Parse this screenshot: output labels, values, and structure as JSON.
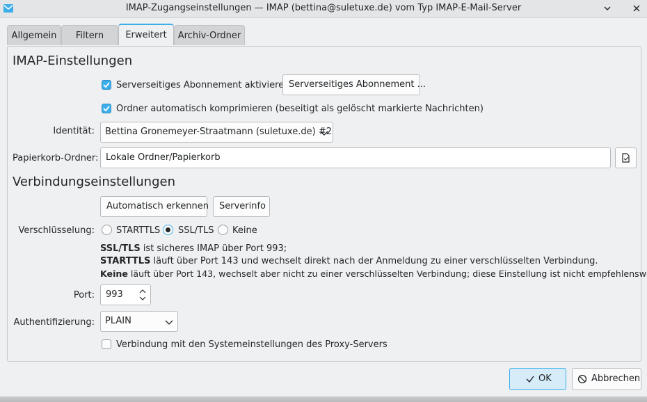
{
  "window": {
    "title": "IMAP-Zugangseinstellungen — IMAP (bettina@suletuxe.de) vom Typ IMAP-E-Mail-Server"
  },
  "tabs": [
    {
      "label": "Allgemein",
      "active": false
    },
    {
      "label": "Filtern",
      "active": false
    },
    {
      "label": "Erweitert",
      "active": true
    },
    {
      "label": "Archiv-Ordner",
      "active": false
    }
  ],
  "imap": {
    "heading": "IMAP-Einstellungen",
    "subscription_label": "Serverseitiges Abonnement aktivieren",
    "subscription_checked": true,
    "subscription_button": "Serverseitiges Abonnement ...",
    "compact_label": "Ordner automatisch komprimieren (beseitigt als gelöscht markierte Nachrichten)",
    "compact_checked": true,
    "identity_label": "Identität:",
    "identity_value": "Bettina Gronemeyer-Straatmann (suletuxe.de) #2",
    "trash_label": "Papierkorb-Ordner:",
    "trash_value": "Lokale Ordner/Papierkorb"
  },
  "connection": {
    "heading": "Verbindungseinstellungen",
    "autodetect_button": "Automatisch erkennen",
    "serverinfo_button": "Serverinfo",
    "encryption_label": "Verschlüsselung:",
    "encryption_options": [
      "STARTTLS",
      "SSL/TLS",
      "Keine"
    ],
    "encryption_selected": "SSL/TLS",
    "info": [
      {
        "bold": "SSL/TLS",
        "text": " ist sicheres IMAP über Port 993;"
      },
      {
        "bold": "STARTTLS",
        "text": " läuft über Port 143 und wechselt direkt nach der Anmeldung zu einer verschlüsselten Verbindung."
      },
      {
        "bold": "Keine",
        "text": " läuft über Port 143, wechselt aber nicht zu einer verschlüsselten Verbindung; diese Einstellung ist nicht empfehlenswert!"
      }
    ],
    "port_label": "Port:",
    "port_value": "993",
    "auth_label": "Authentifizierung:",
    "auth_value": "PLAIN",
    "proxy_label": "Verbindung mit den Systemeinstellungen des Proxy-Servers",
    "proxy_checked": false
  },
  "footer": {
    "ok_label": "OK",
    "cancel_label": "Abbrechen"
  },
  "colors": {
    "accent": "#3daee9",
    "window_bg": "#eff0f1"
  }
}
